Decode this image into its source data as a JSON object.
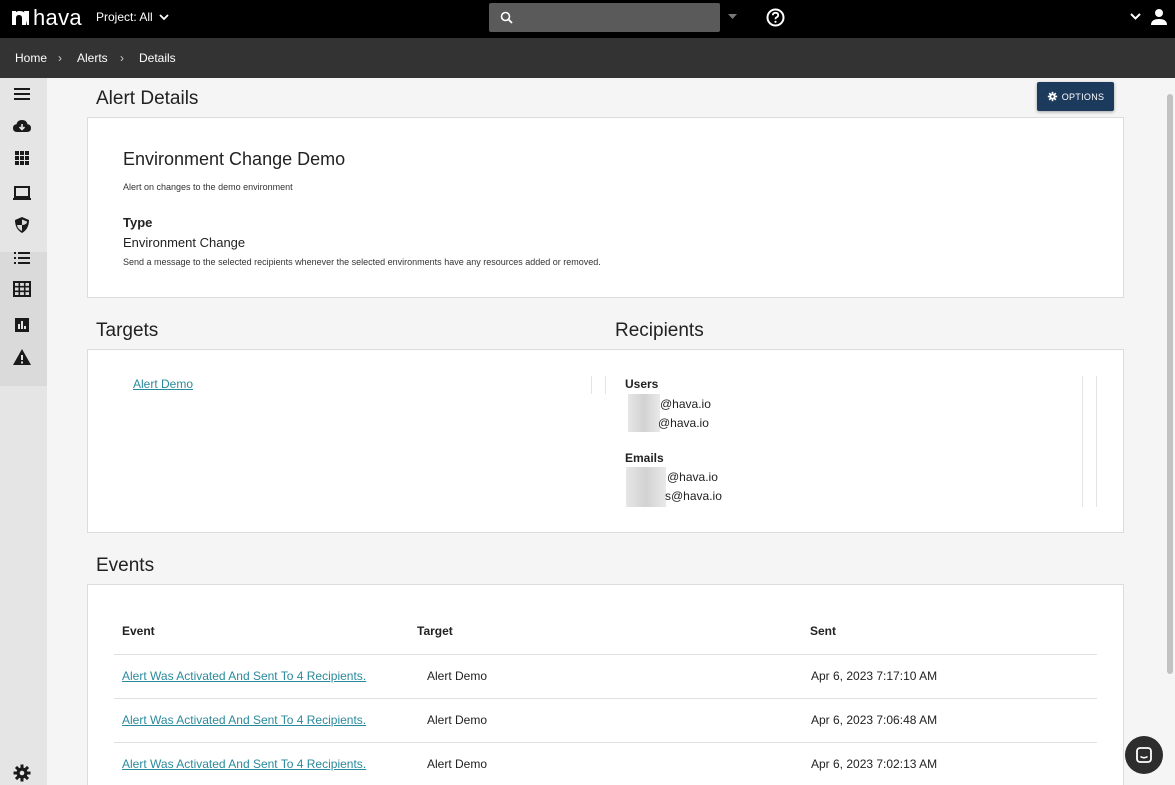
{
  "brand": {
    "name": "hava"
  },
  "header": {
    "project_label": "Project: All",
    "search_placeholder": ""
  },
  "breadcrumb": [
    "Home",
    "Alerts",
    "Details"
  ],
  "breadcrumb_separator": "›",
  "page": {
    "title": "Alert Details",
    "options_label": "OPTIONS"
  },
  "alert": {
    "name": "Environment Change Demo",
    "description": "Alert on changes to the demo environment",
    "type_label": "Type",
    "type_value": "Environment Change",
    "type_description": "Send a message to the selected recipients whenever the selected environments have any resources added or removed."
  },
  "targets": {
    "title": "Targets",
    "items": [
      "Alert Demo"
    ]
  },
  "recipients": {
    "title": "Recipients",
    "users_label": "Users",
    "users": [
      "@hava.io",
      "@hava.io"
    ],
    "emails_label": "Emails",
    "emails": [
      "@hava.io",
      "s@hava.io"
    ]
  },
  "events": {
    "title": "Events",
    "columns": [
      "Event",
      "Target",
      "Sent"
    ],
    "rows": [
      {
        "event": "Alert Was Activated And Sent To 4 Recipients.",
        "target": "Alert Demo",
        "sent": "Apr 6, 2023 7:17:10 AM"
      },
      {
        "event": "Alert Was Activated And Sent To 4 Recipients.",
        "target": "Alert Demo",
        "sent": "Apr 6, 2023 7:06:48 AM"
      },
      {
        "event": "Alert Was Activated And Sent To 4 Recipients.",
        "target": "Alert Demo",
        "sent": "Apr 6, 2023 7:02:13 AM"
      }
    ]
  },
  "sidebar_icons": [
    "menu-icon",
    "cloud-download-icon",
    "apps-grid-icon",
    "laptop-icon",
    "shield-icon",
    "list-icon",
    "table-icon",
    "bar-chart-icon",
    "warning-icon",
    "gear-icon"
  ],
  "colors": {
    "topbar": "#000000",
    "breadcrumb_bar": "#333333",
    "accent_button": "#1c3a5c",
    "link": "#2a8a9c"
  }
}
